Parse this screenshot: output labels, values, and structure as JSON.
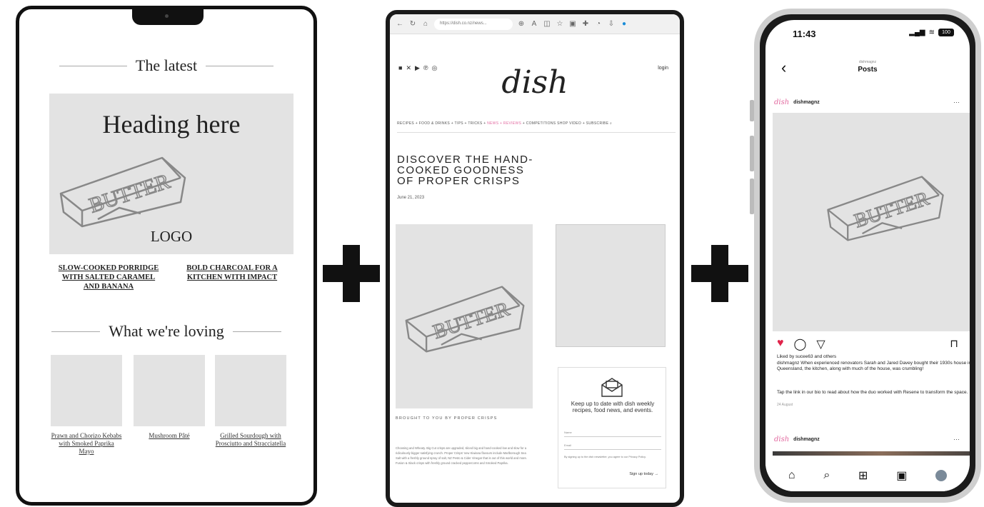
{
  "newsletter": {
    "section_latest": "The latest",
    "hero_heading": "Heading here",
    "hero_logo_text": "LOGO",
    "link_1": "SLOW-COOKED PORRIDGE WITH SALTED CARAMEL AND BANANA",
    "link_2": "BOLD CHARCOAL FOR A KITCHEN WITH IMPACT",
    "section_loving": "What we're loving",
    "thumb_captions": [
      "Prawn and Chorizo Kebabs with Smoked Paprika Mayo",
      "Mushroom Pâté",
      "Grilled Sourdough with Prosciutto and Stracciatella"
    ],
    "butter_label": "BUTTER"
  },
  "browser": {
    "url": "https://dish.co.nz/news...",
    "logo": "dish",
    "login": "login",
    "nav_items": [
      "RECIPES",
      "FOOD & DRINKS",
      "TIPS + TRICKS",
      "NEWS + REVIEWS",
      "COMPETITIONS",
      "SHOP",
      "VIDEO",
      "SUBSCRIBE"
    ],
    "active_nav": "NEWS + REVIEWS",
    "article_title": "DISCOVER THE HAND-COOKED GOODNESS OF PROPER CRISPS",
    "article_date": "June 21, 2023",
    "brought_by": "BROUGHT TO YOU BY PROPER CRISPS",
    "body_text": "Choosing and Wheaty. Big Cut crisps are upgraded, sliced big and hand-cooked low and slow for a ridiculously bigger satisfying crunch. Proper Crisps' new Kiwiana flavours include Marlborough Sea Salt with a freshly ground spray of salt, NZ Pesto & Cider Vinegar that is out of this world and more. Fusion & Slack crisps with freshly ground cracked peppercorns and Smoked Paprika.",
    "signup_text": "Keep up to date with dish weekly recipes, food news, and events.",
    "signup_name_label": "Name",
    "signup_email_label": "Email",
    "signup_terms": "By signing up to the dish newsletter, you agree to our Privacy Policy.",
    "signup_button": "Sign up today →"
  },
  "instagram": {
    "time": "11:43",
    "battery": "100",
    "account_small": "dishmagnz",
    "page_title": "Posts",
    "account": "dishmagnz",
    "mini_logo": "dish",
    "liked_by": "Liked by sucee63 and others",
    "caption": "dishmagnz When experienced renovators Sarah and Jared Davey bought their 1930s house in Queensland, the kitchen, along with much of the house, was crumbling!",
    "tap_text": "Tap the link in our bio to read about how the duo worked with Resene to transform the space.",
    "post_date": "24 August",
    "more": "···"
  }
}
